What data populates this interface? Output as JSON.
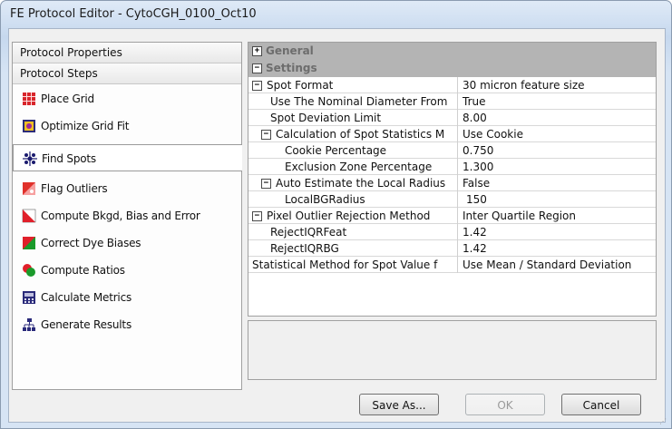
{
  "window": {
    "title": "FE Protocol Editor - CytoCGH_0100_Oct10"
  },
  "left_panel": {
    "headers": [
      "Protocol Properties",
      "Protocol Steps"
    ],
    "steps": [
      {
        "label": "Place Grid",
        "icon": "place-grid-icon"
      },
      {
        "label": "Optimize Grid Fit",
        "icon": "optimize-grid-icon"
      },
      {
        "label": "Find Spots",
        "icon": "find-spots-icon",
        "selected": true
      },
      {
        "label": "Flag Outliers",
        "icon": "flag-outliers-icon"
      },
      {
        "label": "Compute Bkgd, Bias and Error",
        "icon": "compute-bkgd-icon"
      },
      {
        "label": "Correct Dye Biases",
        "icon": "correct-dye-icon"
      },
      {
        "label": "Compute Ratios",
        "icon": "compute-ratios-icon"
      },
      {
        "label": "Calculate Metrics",
        "icon": "calculate-metrics-icon"
      },
      {
        "label": "Generate Results",
        "icon": "generate-results-icon"
      }
    ]
  },
  "property_grid": {
    "categories": [
      {
        "label": "General",
        "expanded": false
      },
      {
        "label": "Settings",
        "expanded": true
      }
    ],
    "rows": [
      {
        "name": "Spot Format",
        "value": "30 micron feature size",
        "level": 0,
        "expander": "minus"
      },
      {
        "name": "Use The Nominal Diameter From",
        "value": "True",
        "level": 1
      },
      {
        "name": "Spot Deviation Limit",
        "value": "8.00",
        "level": 1
      },
      {
        "name": "Calculation of Spot Statistics M",
        "value": "Use Cookie",
        "level": 1,
        "expander": "minus"
      },
      {
        "name": "Cookie Percentage",
        "value": "0.750",
        "level": 2
      },
      {
        "name": "Exclusion Zone Percentage",
        "value": "1.300",
        "level": 2
      },
      {
        "name": "Auto Estimate the Local Radius",
        "value": "False",
        "level": 1,
        "expander": "minus"
      },
      {
        "name": "LocalBGRadius",
        "value": "150",
        "level": 2
      },
      {
        "name": "Pixel Outlier Rejection Method",
        "value": "Inter Quartile Region",
        "level": 0,
        "expander": "minus"
      },
      {
        "name": "RejectIQRFeat",
        "value": "1.42",
        "level": 1
      },
      {
        "name": "RejectIQRBG",
        "value": "1.42",
        "level": 1
      },
      {
        "name": "Statistical Method for Spot Value f",
        "value": "Use Mean / Standard Deviation",
        "level": 0
      }
    ]
  },
  "buttons": {
    "save_as": "Save As...",
    "ok": "OK",
    "cancel": "Cancel"
  },
  "colors": {
    "category_bg": "#b4b4b4",
    "category_text": "#6d6d6d",
    "window_frame": "#c6d8ee"
  }
}
